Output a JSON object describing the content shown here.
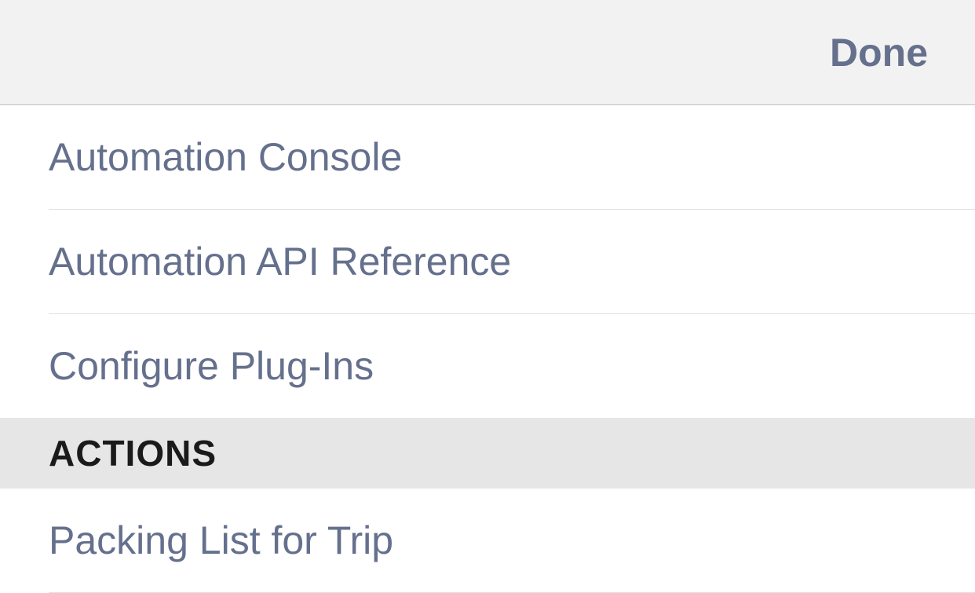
{
  "header": {
    "done_label": "Done"
  },
  "list": {
    "items": [
      {
        "label": "Automation Console"
      },
      {
        "label": "Automation API Reference"
      },
      {
        "label": "Configure Plug-Ins"
      }
    ]
  },
  "section": {
    "title": "ACTIONS",
    "items": [
      {
        "label": "Packing List for Trip"
      }
    ]
  }
}
